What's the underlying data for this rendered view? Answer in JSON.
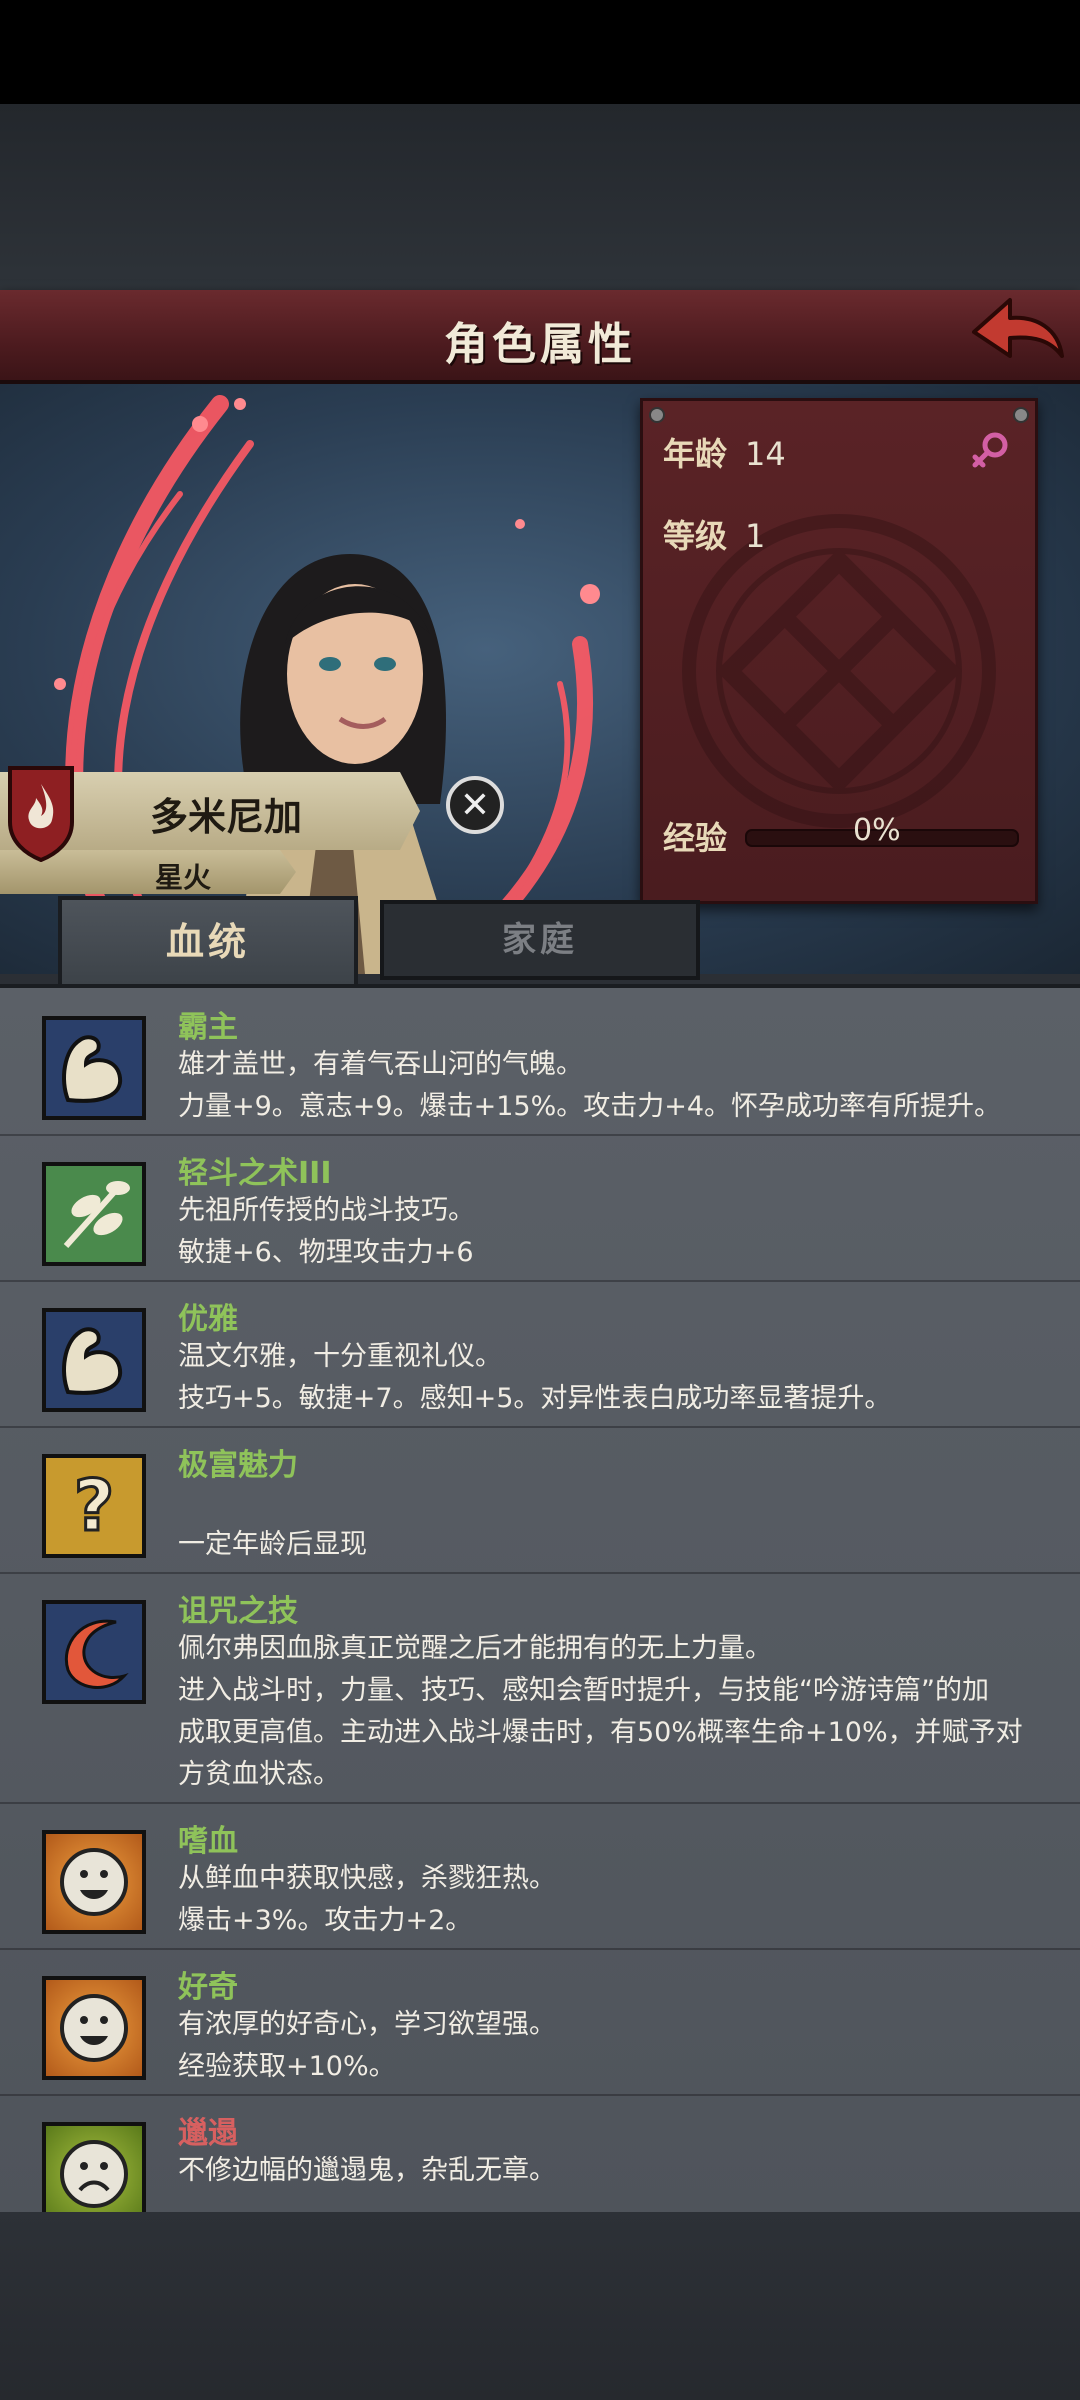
{
  "header": {
    "title": "角色属性"
  },
  "character": {
    "name": "多米尼加",
    "title": "星火",
    "age_label": "年龄",
    "age": "14",
    "level_label": "等级",
    "level": "1",
    "exp_label": "经验",
    "exp_value": "0%",
    "exp_progress": 0
  },
  "tabs": [
    {
      "label": "血统",
      "active": true
    },
    {
      "label": "家庭",
      "active": false
    }
  ],
  "traits": [
    {
      "name": "霸主",
      "desc": [
        "雄才盖世，有着气吞山河的气魄。",
        "力量+9。意志+9。爆击+15%。攻击力+4。怀孕成功率有所提升。"
      ],
      "icon": "flexed-arm-icon",
      "negative": false
    },
    {
      "name": "轻斗之术III",
      "desc": [
        "先祖所传授的战斗技巧。",
        "敏捷+6、物理攻击力+6"
      ],
      "icon": "leaf-branch-icon",
      "negative": false
    },
    {
      "name": "优雅",
      "desc": [
        "温文尔雅，十分重视礼仪。",
        "技巧+5。敏捷+7。感知+5。对异性表白成功率显著提升。"
      ],
      "icon": "flexed-arm-icon",
      "negative": false
    },
    {
      "name": "极富魅力",
      "desc": [
        "",
        "一定年龄后显现"
      ],
      "icon": "question-mark-icon",
      "negative": false
    },
    {
      "name": "诅咒之技",
      "desc": [
        "佩尔弗因血脉真正觉醒之后才能拥有的无上力量。",
        "进入战斗时，力量、技巧、感知会暂时提升，与技能“吟游诗篇”的加",
        "成取更高值。主动进入战斗爆击时，有50%概率生命+10%，并赋予对",
        "方贫血状态。"
      ],
      "icon": "crescent-flame-icon",
      "negative": false
    },
    {
      "name": "嗜血",
      "desc": [
        "从鲜血中获取快感，杀戮狂热。",
        "爆击+3%。攻击力+2。"
      ],
      "icon": "smiley-face-icon",
      "negative": false
    },
    {
      "name": "好奇",
      "desc": [
        "有浓厚的好奇心，学习欲望强。",
        "经验获取+10%。"
      ],
      "icon": "smiley-face-icon",
      "negative": false
    },
    {
      "name": "邋遢",
      "desc": [
        "不修边幅的邋遢鬼，杂乱无章。"
      ],
      "icon": "sad-face-icon",
      "negative": true
    }
  ],
  "colors": {
    "positive_trait": "#8fc35a",
    "negative_trait": "#d76060",
    "banner": "#5a2326"
  }
}
